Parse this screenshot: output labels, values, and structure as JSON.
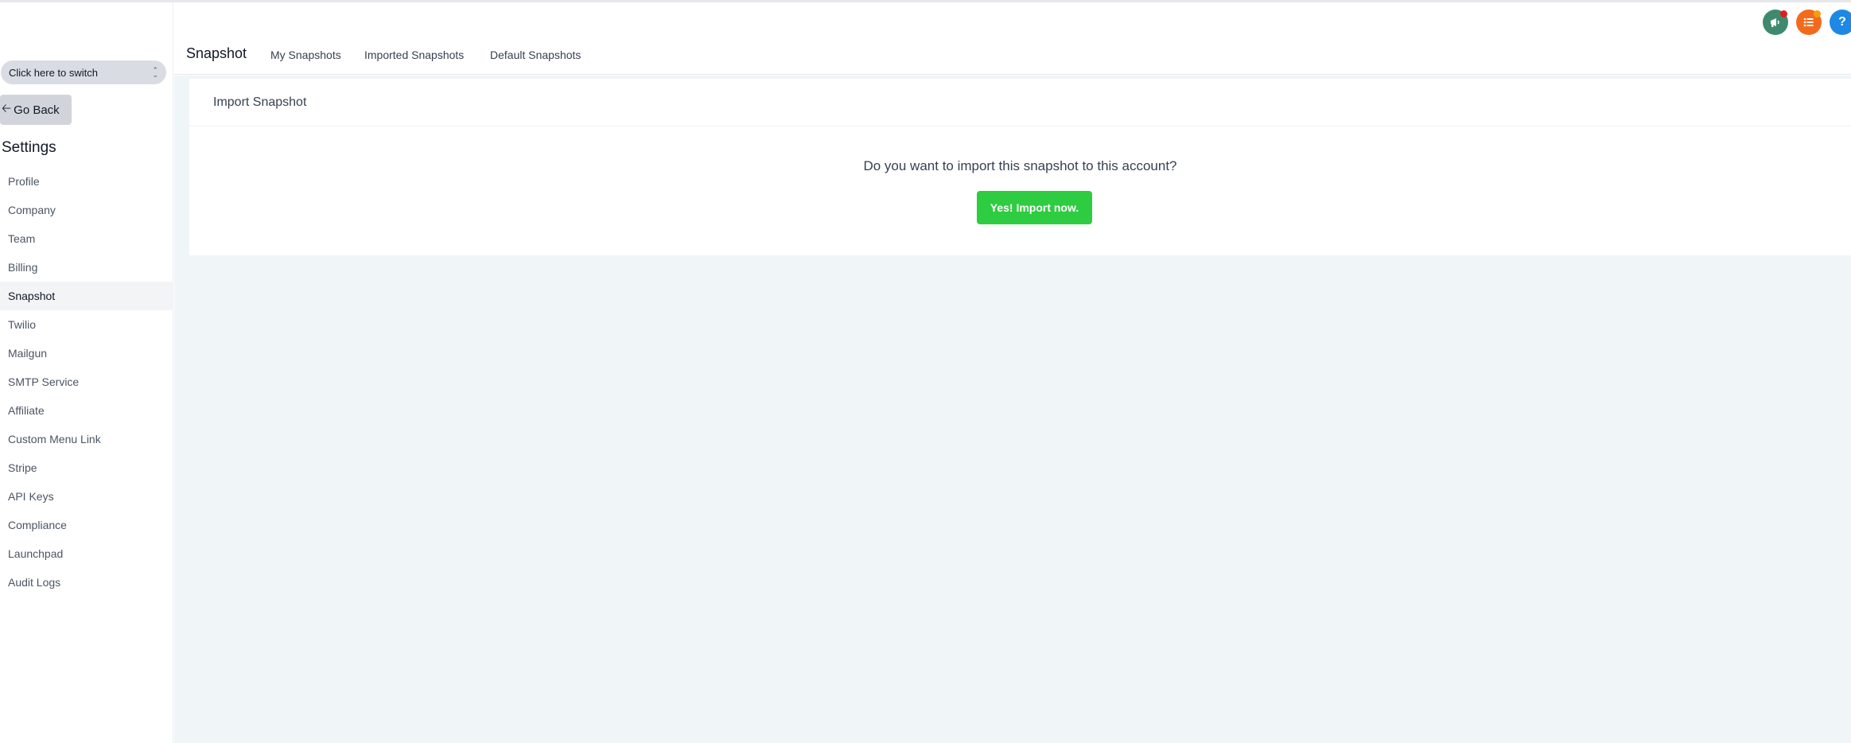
{
  "sidebar": {
    "switcher_label": "Click here to switch",
    "go_back_label": "Go Back",
    "settings_title": "Settings",
    "items": [
      {
        "label": "Profile"
      },
      {
        "label": "Company"
      },
      {
        "label": "Team"
      },
      {
        "label": "Billing"
      },
      {
        "label": "Snapshot",
        "active": true
      },
      {
        "label": "Twilio"
      },
      {
        "label": "Mailgun"
      },
      {
        "label": "SMTP Service"
      },
      {
        "label": "Affiliate"
      },
      {
        "label": "Custom Menu Link"
      },
      {
        "label": "Stripe"
      },
      {
        "label": "API Keys"
      },
      {
        "label": "Compliance"
      },
      {
        "label": "Launchpad"
      },
      {
        "label": "Audit Logs"
      }
    ]
  },
  "header": {
    "title": "Snapshot",
    "tabs": [
      {
        "label": "My Snapshots"
      },
      {
        "label": "Imported Snapshots"
      },
      {
        "label": "Default Snapshots"
      }
    ],
    "icons": [
      {
        "name": "megaphone-icon",
        "color": "#3f8a6f"
      },
      {
        "name": "list-icon",
        "color": "#f26b1d"
      },
      {
        "name": "help-icon",
        "color": "#1e88e5",
        "glyph": "?"
      }
    ]
  },
  "card": {
    "title": "Import Snapshot",
    "question": "Do you want to import this snapshot to this account?",
    "import_button": "Yes! Import now."
  },
  "colors": {
    "accent_green": "#2ecc40",
    "page_bg": "#f0f5f8"
  }
}
